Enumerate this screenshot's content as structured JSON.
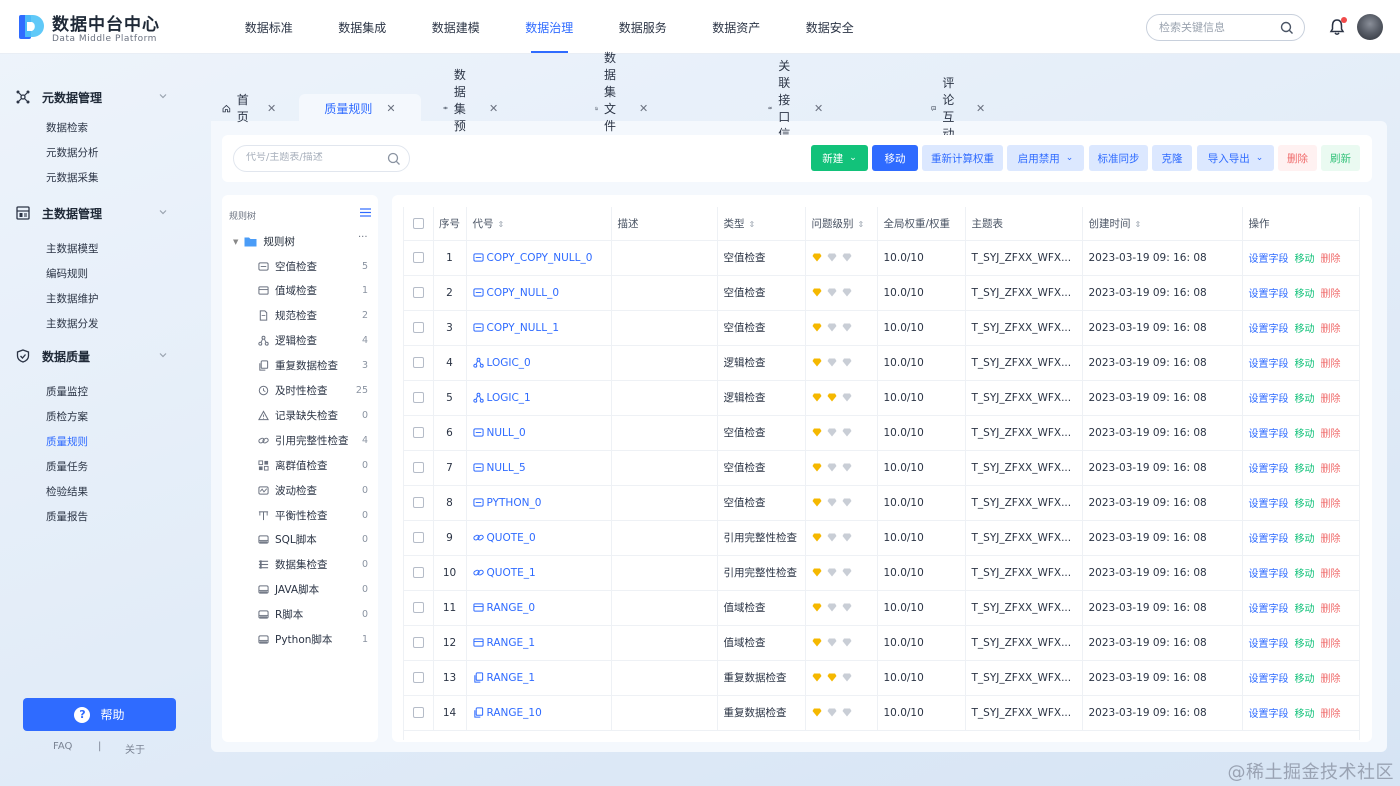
{
  "brand": {
    "title": "数据中台中心",
    "subtitle": "Data Middle Platform"
  },
  "nav": [
    {
      "label": "数据标准"
    },
    {
      "label": "数据集成"
    },
    {
      "label": "数据建模"
    },
    {
      "label": "数据治理",
      "active": true
    },
    {
      "label": "数据服务"
    },
    {
      "label": "数据资产"
    },
    {
      "label": "数据安全"
    }
  ],
  "search": {
    "placeholder": "检索关键信息"
  },
  "sidebar": {
    "sections": [
      {
        "label": "元数据管理",
        "items": [
          "数据检索",
          "元数据分析",
          "元数据采集"
        ]
      },
      {
        "label": "主数据管理",
        "items": [
          "主数据模型",
          "编码规则",
          "主数据维护",
          "主数据分发"
        ]
      },
      {
        "label": "数据质量",
        "items": [
          "质量监控",
          "质检方案",
          "质量规则",
          "质量任务",
          "检验结果",
          "质量报告"
        ]
      }
    ],
    "active_item": "质量规则",
    "help_label": "帮助",
    "faq": "FAQ",
    "sep": "|",
    "about": "关于"
  },
  "tabs": [
    {
      "label": "首页"
    },
    {
      "label": "质量规则",
      "active": true
    },
    {
      "label": "数据集预览"
    },
    {
      "label": "数据集文件列表"
    },
    {
      "label": "关联接口信息"
    },
    {
      "label": "评论互动"
    }
  ],
  "filter": {
    "placeholder": "代号/主题表/描述"
  },
  "toolbar": {
    "new": "新建",
    "move": "移动",
    "recalc": "重新计算权重",
    "enable": "启用禁用",
    "sync": "标准同步",
    "clone": "克隆",
    "import": "导入导出",
    "delete": "删除",
    "refresh": "刷新"
  },
  "tree": {
    "title": "规则树",
    "root": "规则树",
    "items": [
      {
        "label": "空值检查",
        "count": "5",
        "icon": "null-check"
      },
      {
        "label": "值域检查",
        "count": "1",
        "icon": "range"
      },
      {
        "label": "规范检查",
        "count": "2",
        "icon": "doc"
      },
      {
        "label": "逻辑检查",
        "count": "4",
        "icon": "logic"
      },
      {
        "label": "重复数据检查",
        "count": "3",
        "icon": "copy"
      },
      {
        "label": "及时性检查",
        "count": "25",
        "icon": "clock"
      },
      {
        "label": "记录缺失检查",
        "count": "0",
        "icon": "warn"
      },
      {
        "label": "引用完整性检查",
        "count": "4",
        "icon": "link"
      },
      {
        "label": "离群值检查",
        "count": "0",
        "icon": "grid"
      },
      {
        "label": "波动检查",
        "count": "0",
        "icon": "wave"
      },
      {
        "label": "平衡性检查",
        "count": "0",
        "icon": "balance"
      },
      {
        "label": "SQL脚本",
        "count": "0",
        "icon": "script"
      },
      {
        "label": "数据集检查",
        "count": "0",
        "icon": "dataset"
      },
      {
        "label": "JAVA脚本",
        "count": "0",
        "icon": "script"
      },
      {
        "label": "R脚本",
        "count": "0",
        "icon": "script"
      },
      {
        "label": "Python脚本",
        "count": "1",
        "icon": "script"
      }
    ]
  },
  "table": {
    "headers": {
      "no": "序号",
      "code": "代号",
      "desc": "描述",
      "type": "类型",
      "level": "问题级别",
      "weight": "全局权重/权重",
      "subject": "主题表",
      "created": "创建时间",
      "ops": "操作"
    },
    "ops": {
      "set": "设置字段",
      "move": "移动",
      "del": "删除"
    },
    "level_colors": {
      "active": "#f5b800",
      "inactive": "#c9ced6"
    },
    "rows": [
      {
        "no": "1",
        "code": "COPY_COPY_NULL_0",
        "icon": "null-check",
        "desc": "",
        "type": "空值检查",
        "level": 1,
        "weight": "10.0/10",
        "subject": "T_SYJ_ZFXX_WFX...",
        "created": "2023-03-19 09: 16: 08"
      },
      {
        "no": "2",
        "code": "COPY_NULL_0",
        "icon": "null-check",
        "desc": "",
        "type": "空值检查",
        "level": 1,
        "weight": "10.0/10",
        "subject": "T_SYJ_ZFXX_WFX...",
        "created": "2023-03-19 09: 16: 08"
      },
      {
        "no": "3",
        "code": "COPY_NULL_1",
        "icon": "null-check",
        "desc": "",
        "type": "空值检查",
        "level": 1,
        "weight": "10.0/10",
        "subject": "T_SYJ_ZFXX_WFX...",
        "created": "2023-03-19 09: 16: 08"
      },
      {
        "no": "4",
        "code": "LOGIC_0",
        "icon": "logic",
        "desc": "",
        "type": "逻辑检查",
        "level": 1,
        "weight": "10.0/10",
        "subject": "T_SYJ_ZFXX_WFX...",
        "created": "2023-03-19 09: 16: 08"
      },
      {
        "no": "5",
        "code": "LOGIC_1",
        "icon": "logic",
        "desc": "",
        "type": "逻辑检查",
        "level": 2,
        "weight": "10.0/10",
        "subject": "T_SYJ_ZFXX_WFX...",
        "created": "2023-03-19 09: 16: 08"
      },
      {
        "no": "6",
        "code": "NULL_0",
        "icon": "null-check",
        "desc": "",
        "type": "空值检查",
        "level": 1,
        "weight": "10.0/10",
        "subject": "T_SYJ_ZFXX_WFX...",
        "created": "2023-03-19 09: 16: 08"
      },
      {
        "no": "7",
        "code": "NULL_5",
        "icon": "null-check",
        "desc": "",
        "type": "空值检查",
        "level": 1,
        "weight": "10.0/10",
        "subject": "T_SYJ_ZFXX_WFX...",
        "created": "2023-03-19 09: 16: 08"
      },
      {
        "no": "8",
        "code": "PYTHON_0",
        "icon": "null-check",
        "desc": "",
        "type": "空值检查",
        "level": 1,
        "weight": "10.0/10",
        "subject": "T_SYJ_ZFXX_WFX...",
        "created": "2023-03-19 09: 16: 08"
      },
      {
        "no": "9",
        "code": "QUOTE_0",
        "icon": "link",
        "desc": "",
        "type": "引用完整性检查",
        "level": 1,
        "weight": "10.0/10",
        "subject": "T_SYJ_ZFXX_WFX...",
        "created": "2023-03-19 09: 16: 08"
      },
      {
        "no": "10",
        "code": "QUOTE_1",
        "icon": "link",
        "desc": "",
        "type": "引用完整性检查",
        "level": 1,
        "weight": "10.0/10",
        "subject": "T_SYJ_ZFXX_WFX...",
        "created": "2023-03-19 09: 16: 08"
      },
      {
        "no": "11",
        "code": "RANGE_0",
        "icon": "range",
        "desc": "",
        "type": "值域检查",
        "level": 1,
        "weight": "10.0/10",
        "subject": "T_SYJ_ZFXX_WFX...",
        "created": "2023-03-19 09: 16: 08"
      },
      {
        "no": "12",
        "code": "RANGE_1",
        "icon": "range",
        "desc": "",
        "type": "值域检查",
        "level": 1,
        "weight": "10.0/10",
        "subject": "T_SYJ_ZFXX_WFX...",
        "created": "2023-03-19 09: 16: 08"
      },
      {
        "no": "13",
        "code": "RANGE_1",
        "icon": "copy",
        "desc": "",
        "type": "重复数据检查",
        "level": 2,
        "weight": "10.0/10",
        "subject": "T_SYJ_ZFXX_WFX...",
        "created": "2023-03-19 09: 16: 08"
      },
      {
        "no": "14",
        "code": "RANGE_10",
        "icon": "copy",
        "desc": "",
        "type": "重复数据检查",
        "level": 1,
        "weight": "10.0/10",
        "subject": "T_SYJ_ZFXX_WFX...",
        "created": "2023-03-19 09: 16: 08"
      }
    ]
  },
  "watermark": "@稀土掘金技术社区"
}
